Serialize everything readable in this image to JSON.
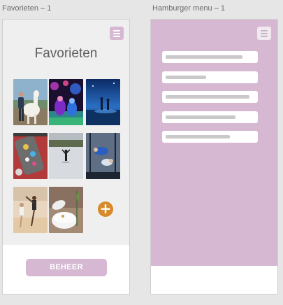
{
  "artboards": [
    {
      "label": "Favorieten – 1"
    },
    {
      "label": "Hamburger menu – 1"
    }
  ],
  "favorieten": {
    "title": "Favorieten",
    "menu_icon": "hamburger-icon",
    "add_icon": "plus-icon",
    "add_symbol": "+",
    "manage_button": "BEHEER",
    "photos": [
      "photo-alpaca-woman",
      "photo-neon-party",
      "photo-night-beach",
      "photo-stickers-hand",
      "photo-ice-skater",
      "photo-skydiving-tunnel",
      "photo-beach-yoga",
      "photo-cake-rings"
    ]
  },
  "hamburger_menu": {
    "menu_icon": "hamburger-icon",
    "items": [
      {
        "name": "menu-item-1"
      },
      {
        "name": "menu-item-2"
      },
      {
        "name": "menu-item-3"
      },
      {
        "name": "menu-item-4"
      },
      {
        "name": "menu-item-5"
      }
    ]
  },
  "colors": {
    "accent": "#d6b8d3",
    "add_button": "#d68a2a",
    "canvas": "#e6e6e6",
    "artboard_top": "#efefef",
    "placeholder_bar": "#c9c9c9"
  }
}
